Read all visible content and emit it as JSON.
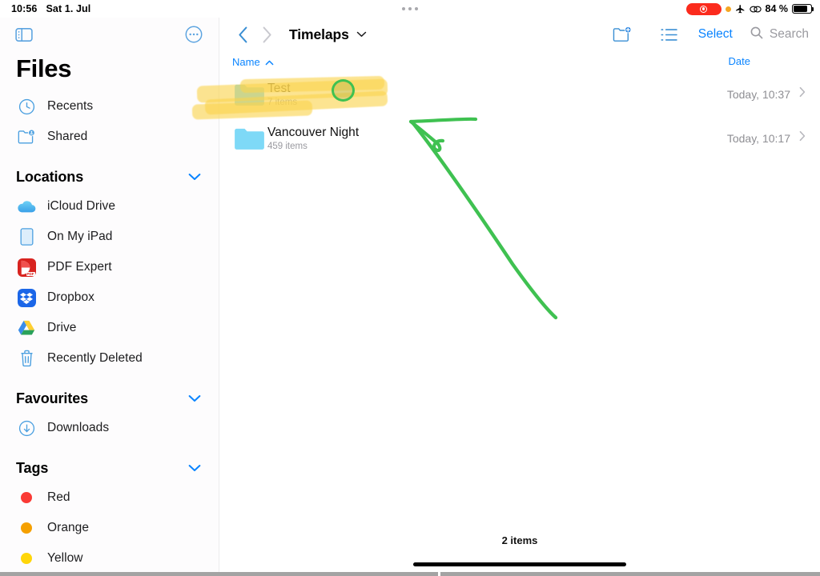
{
  "status_bar": {
    "time": "10:56",
    "date": "Sat 1. Jul",
    "battery_percent": "84 %",
    "icons": [
      "screen-recording-pill",
      "orange-privacy-dot",
      "airplane-mode-icon",
      "screen-mirroring-icon",
      "battery-icon"
    ],
    "multitask_handle": "three-dots"
  },
  "sidebar": {
    "title": "Files",
    "toggle_icon": "sidebar-toggle-icon",
    "more_icon": "more-circle-icon",
    "top_items": [
      {
        "label": "Recents",
        "icon": "clock-icon"
      },
      {
        "label": "Shared",
        "icon": "shared-folder-icon"
      }
    ],
    "sections": [
      {
        "title": "Locations",
        "collapse_icon": "chevron-down-icon",
        "items": [
          {
            "label": "iCloud Drive",
            "icon": "icloud-icon"
          },
          {
            "label": "On My iPad",
            "icon": "ipad-icon"
          },
          {
            "label": "PDF Expert",
            "icon": "pdf-expert-icon"
          },
          {
            "label": "Dropbox",
            "icon": "dropbox-icon"
          },
          {
            "label": "Drive",
            "icon": "google-drive-icon"
          },
          {
            "label": "Recently Deleted",
            "icon": "trash-icon"
          }
        ]
      },
      {
        "title": "Favourites",
        "collapse_icon": "chevron-down-icon",
        "items": [
          {
            "label": "Downloads",
            "icon": "download-circle-icon"
          }
        ]
      },
      {
        "title": "Tags",
        "collapse_icon": "chevron-down-icon",
        "items": [
          {
            "label": "Red",
            "icon": "tag-dot-icon",
            "color": "#fa3a35"
          },
          {
            "label": "Orange",
            "icon": "tag-dot-icon",
            "color": "#f5a000"
          },
          {
            "label": "Yellow",
            "icon": "tag-dot-icon",
            "color": "#ffd60a"
          }
        ]
      }
    ]
  },
  "main": {
    "back_icon": "chevron-left-icon",
    "forward_icon": "chevron-right-icon",
    "folder_title": "Timelaps",
    "title_chevron_icon": "chevron-down-icon",
    "new_folder_icon": "new-folder-icon",
    "list_view_icon": "list-view-icon",
    "select_label": "Select",
    "search_icon": "search-icon",
    "search_placeholder": "Search",
    "columns": {
      "name": "Name",
      "name_sort_icon": "chevron-up-icon",
      "date": "Date"
    },
    "rows": [
      {
        "name": "Test",
        "subtitle": "7 items",
        "date": "Today, 10:37",
        "icon": "folder-icon",
        "disclosure_icon": "chevron-right-icon",
        "highlighted": true
      },
      {
        "name": "Vancouver Night",
        "subtitle": "459 items",
        "date": "Today, 10:17",
        "icon": "folder-icon",
        "disclosure_icon": "chevron-right-icon",
        "highlighted": false
      }
    ],
    "items_count": "2 items"
  },
  "annotations": {
    "highlighter_color": "#fbd44e",
    "arrow_color": "#3fc151",
    "circle_color": "#3fc151",
    "arrow_icon": "hand-drawn-arrow",
    "circle_icon": "hand-drawn-circle"
  },
  "colors": {
    "accent_blue": "#0a84ff",
    "folder_blue": "#7ed9f7",
    "text_primary": "#111111",
    "text_secondary": "#8e8e93"
  }
}
